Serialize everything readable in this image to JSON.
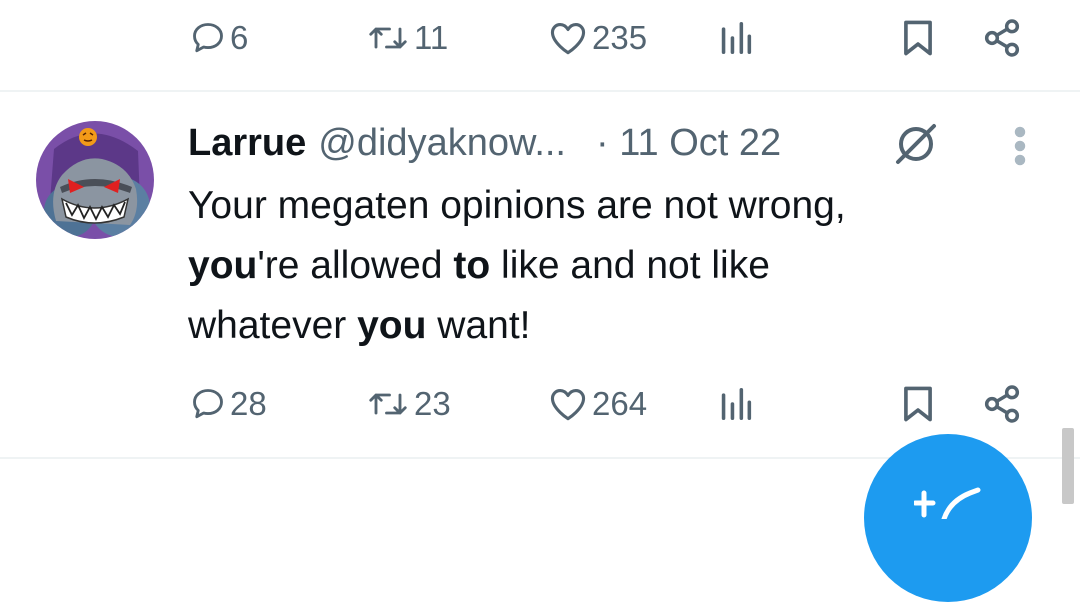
{
  "top_tweet_actions": {
    "replies": "6",
    "retweets": "11",
    "likes": "235"
  },
  "tweet": {
    "author_name": "Larrue",
    "author_handle": "@didyaknow...",
    "date": "· 11 Oct 22",
    "text": {
      "l1": "Your megaten opinions are not wrong,",
      "l2_b1": "you",
      "l2_t1": "'re allowed ",
      "l2_b2": "to",
      "l2_t2": " like and not like",
      "l3_t1": "whatever ",
      "l3_b1": "you",
      "l3_t2": " want!"
    },
    "actions": {
      "replies": "28",
      "retweets": "23",
      "likes": "264"
    }
  },
  "icons": {
    "reply": "reply-icon",
    "retweet": "retweet-icon",
    "like": "heart-icon",
    "views": "views-icon",
    "bookmark": "bookmark-icon",
    "share": "share-icon",
    "no_edit": "no-edit-icon",
    "more": "more-icon",
    "compose": "compose-icon"
  },
  "colors": {
    "text": "#0f1419",
    "secondary": "#536471",
    "accent": "#1d9bf0",
    "divider": "#eff3f4"
  }
}
